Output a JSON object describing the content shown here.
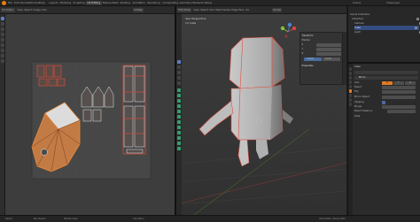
{
  "topbar": {
    "menus": [
      "File",
      "Edit",
      "Render",
      "Window",
      "Help"
    ],
    "workspaces": [
      "Layout",
      "Modeling",
      "Sculpting",
      "UV Editing",
      "Texture Paint",
      "Shading",
      "Animation",
      "Rendering",
      "Compositing",
      "Geometry Nodes",
      "Scripting"
    ],
    "active_workspace": "UV Editing",
    "scene": "Scene",
    "view_layer": "ViewLayer"
  },
  "uv_editor": {
    "header": {
      "mode": "UV Editor",
      "menus": [
        "View",
        "Select",
        "Image",
        "UVs"
      ],
      "image": "UVMap"
    },
    "tools_count": 9
  },
  "viewport": {
    "header": {
      "mode": "Edit Mode",
      "menus": [
        "View",
        "Select",
        "Add",
        "Mesh",
        "Vertex",
        "Edge",
        "Face",
        "UV"
      ],
      "orientation": "Global"
    },
    "overlay_text": {
      "line1": "User Perspective",
      "line2": "(1) Cube"
    },
    "n_panel": {
      "title": "Transform",
      "rows": [
        "Median:",
        "X",
        "Y",
        "Z",
        "Global",
        "Local"
      ],
      "section": "Properties"
    },
    "gizmo": {
      "x": "X",
      "y": "Y",
      "z": "Z"
    }
  },
  "outliner": {
    "search_placeholder": "",
    "rows": [
      {
        "label": "Scene Collection",
        "selected": false
      },
      {
        "label": "Collection",
        "selected": false
      },
      {
        "label": "Camera",
        "selected": false
      },
      {
        "label": "Cube",
        "selected": true
      },
      {
        "label": "Light",
        "selected": false
      }
    ]
  },
  "properties": {
    "header": "Cube",
    "modifier_name": "Mirror",
    "rows": [
      "Axis",
      "Bisect",
      "Flip",
      "Mirror Object",
      "Clipping",
      "Merge",
      "Bisect Distance",
      "Data"
    ],
    "axis_buttons": [
      "X",
      "Y",
      "Z"
    ]
  },
  "status": {
    "left": [
      "Select",
      "Box Select",
      "Rotate View"
    ],
    "right": "Call Menu",
    "stats": "Verts 8/64 | Faces 6/62"
  },
  "colors": {
    "accent": "#e37b25",
    "selection": "#334d80",
    "mesh_edge": "#e05040",
    "uv_fill": "#c97840",
    "gizmo_x": "#e0443c",
    "gizmo_y": "#7fc33a",
    "gizmo_z": "#4a86d8"
  }
}
